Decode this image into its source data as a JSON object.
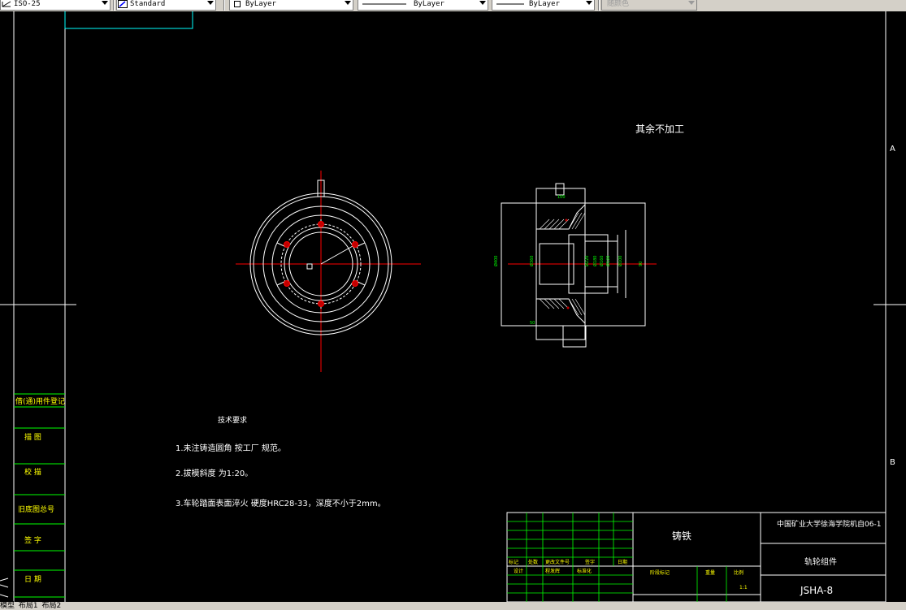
{
  "toolbar": {
    "dimstyle": "ISO-25",
    "textstyle": "Standard",
    "layer": "ByLayer",
    "linetype": "ByLayer",
    "lineweight": "ByLayer",
    "plotstyle": "随颜色"
  },
  "drawing": {
    "note_rest": "其余不加工",
    "tech_title": "技术要求",
    "tech_items": [
      "1.未注铸造圆角    按工厂  规范。",
      "2.拔模斜度    为1:20。",
      "3.车轮踏面表面淬火       硬度HRC28-33，深度不小于2mm。"
    ],
    "zone_labels": [
      "A",
      "B"
    ],
    "left_column": [
      "借(通)用件登记",
      "描  图",
      "校  描",
      "旧底图总号",
      "签  字",
      "日  期"
    ],
    "title_block": {
      "material": "铸铁",
      "school": "中国矿业大学徐海学院机自06-1",
      "part_name": "轨轮组件",
      "drawing_no": "JSHA-8",
      "scale_header": "比例",
      "weight_header": "重量",
      "stage_header": "阶段标记",
      "scale_value": "1:1",
      "row_labels": [
        "标记",
        "处数",
        "更改文件号",
        "签字",
        "日期"
      ],
      "designer_label": "设计",
      "standard_label": "标准化",
      "designer_name": "程发辉"
    },
    "dimension_values": [
      "Ø400",
      "Ø360",
      "Ø220",
      "Ø180",
      "Ø160",
      "Ø120",
      "Ø100",
      "90",
      "100",
      "50"
    ]
  },
  "statusbar": {
    "model_tab": "模型",
    "layout1_tab": "布局1",
    "layout2_tab": "布局2"
  },
  "colors": {
    "background": "#000000",
    "line": "#ffffff",
    "border": "#00ffff",
    "center": "#ff0000",
    "dimension": "#00ff00",
    "toolbar": "#d4d0c8"
  }
}
